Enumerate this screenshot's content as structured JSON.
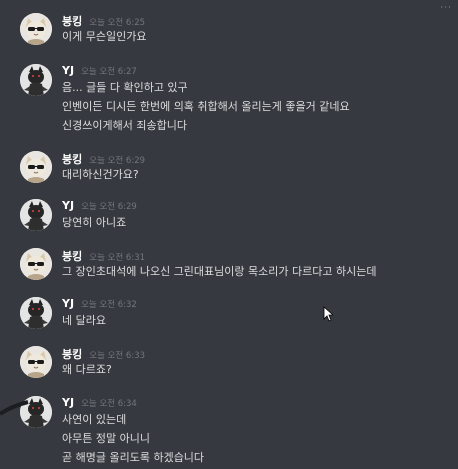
{
  "colors": {
    "background": "#36393f",
    "username": "#ffffff",
    "timestamp": "#72767d",
    "message_text": "#dcddde"
  },
  "top_right_indicator": "···",
  "messages": [
    {
      "user": "붕킹",
      "time": "오늘 오전 6:25",
      "avatar": "cat-sunglasses-avatar",
      "lines": [
        "이게 무슨일인가요"
      ]
    },
    {
      "user": "YJ",
      "time": "오늘 오전 6:27",
      "avatar": "dark-character-avatar",
      "lines": [
        "음... 글들 다 확인하고 있구",
        "인벤이든 디시든 한번에 의혹 취합해서 올리는게 좋을거 같네요",
        "신경쓰이게해서 죄송합니다"
      ]
    },
    {
      "user": "붕킹",
      "time": "오늘 오전 6:29",
      "avatar": "cat-sunglasses-avatar",
      "lines": [
        "대리하신건가요?"
      ]
    },
    {
      "user": "YJ",
      "time": "오늘 오전 6:29",
      "avatar": "dark-character-avatar",
      "lines": [
        "당연히 아니죠"
      ]
    },
    {
      "user": "붕킹",
      "time": "오늘 오전 6:31",
      "avatar": "cat-sunglasses-avatar",
      "lines": [
        "그 장인초대석에 나오신 그린대표님이랑 목소리가 다르다고 하시는데"
      ]
    },
    {
      "user": "YJ",
      "time": "오늘 오전 6:32",
      "avatar": "dark-character-avatar",
      "lines": [
        "네 달라요"
      ]
    },
    {
      "user": "붕킹",
      "time": "오늘 오전 6:33",
      "avatar": "cat-sunglasses-avatar",
      "lines": [
        "왜 다르죠?"
      ]
    },
    {
      "user": "YJ",
      "time": "오늘 오전 6:34",
      "avatar": "dark-character-avatar",
      "lines": [
        "사연이 있는데",
        "아무튼 정말 아니니",
        "곧 해명글 올리도록 하겠습니다"
      ]
    }
  ]
}
